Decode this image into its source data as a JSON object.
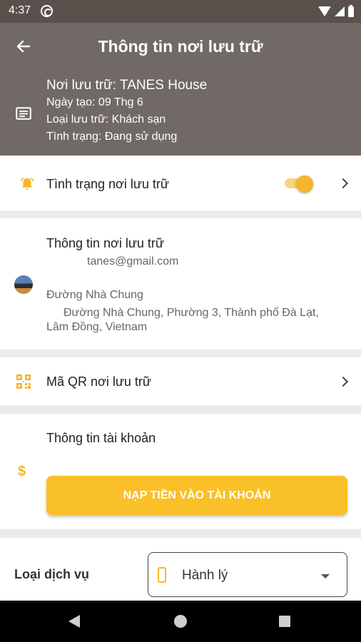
{
  "status_bar": {
    "time": "4:37"
  },
  "header": {
    "title": "Thông tin nơi lưu trữ",
    "storage_name": "Nơi lưu trữ: TANES House",
    "created_date": "Ngày tạo: 09 Thg 6",
    "storage_type": "Loại lưu trữ: Khách sạn",
    "status": "Tình trạng: Đang sử dụng"
  },
  "status_row": {
    "label": "Tình trạng nơi lưu trữ",
    "toggle_on": true
  },
  "info_card": {
    "title": "Thông tin nơi lưu trữ",
    "email": "tanes@gmail.com",
    "street": "Đường Nhà Chung",
    "address_line1": "Đường Nhà Chung, Phường 3, Thành phố Đà Lạt,",
    "address_line2": "Lâm Đồng, Vietnam"
  },
  "qr_row": {
    "label": "Mã QR nơi lưu trữ"
  },
  "account_card": {
    "title": "Thông tin tài khoản",
    "deposit_button": "NẠP TIỀN VÀO TÀI KHOẢN"
  },
  "service": {
    "label": "Loại dịch vụ",
    "selected": "Hành lý"
  },
  "colors": {
    "accent": "#f9c02a",
    "header_bg": "#716966",
    "statusbar_bg": "#5a514c"
  }
}
